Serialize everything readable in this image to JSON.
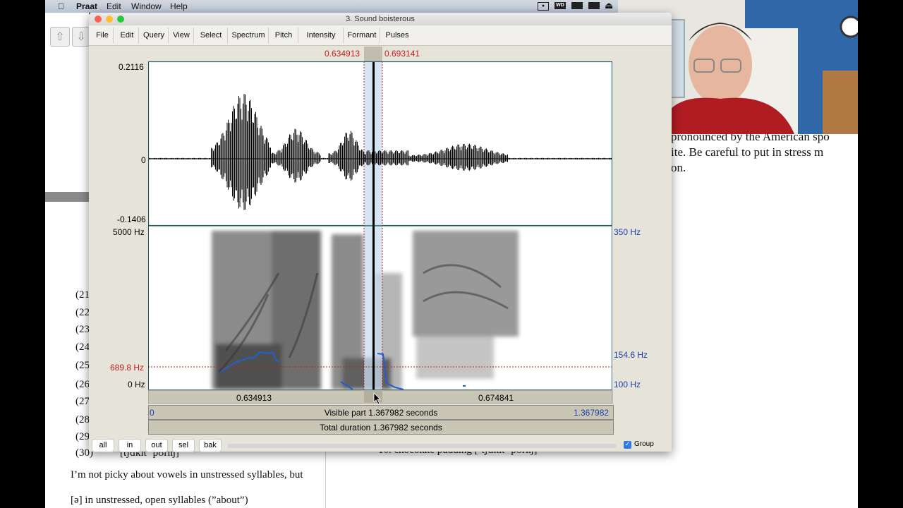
{
  "menubar": {
    "apple": "",
    "app": "Praat",
    "items": [
      "Edit",
      "Window",
      "Help"
    ]
  },
  "window": {
    "title": "3. Sound boisterous",
    "menus": [
      "File",
      "Edit",
      "Query",
      "View",
      "Select",
      "Spectrum",
      "Pitch",
      "Intensity",
      "Formant",
      "Pulses"
    ]
  },
  "selection": {
    "start": "0.634913",
    "end": "0.693141"
  },
  "waveform": {
    "ymax": "0.2116",
    "zero": "0",
    "ymin": "-0.1406"
  },
  "spectrogram": {
    "fmax": "5000 Hz",
    "fmin": "0 Hz",
    "cursor_freq": "689.8 Hz",
    "pitch_max": "350 Hz",
    "pitch_cursor": "154.6 Hz",
    "pitch_min": "100 Hz"
  },
  "time_bars": {
    "left_segment": "0.634913",
    "right_segment": "0.674841",
    "visible_start": "0",
    "visible_label": "Visible part 1.367982 seconds",
    "visible_end": "1.367982",
    "total_label": "Total duration 1.367982 seconds"
  },
  "bottom": {
    "buttons": [
      "all",
      "in",
      "out",
      "sel",
      "bak"
    ],
    "group_label": "Group",
    "group_checked": true
  },
  "document": {
    "right_lines": [
      "pronounced by the American spo",
      "ite.  Be careful to put in stress m",
      "on."
    ],
    "left_numbers": [
      "(21",
      "(22",
      "(23",
      "(24",
      "(25",
      "(26",
      "(27",
      "(28",
      "(29",
      "(30)"
    ],
    "item30": "[tʃɑkit ˈpʊɾiŋ]",
    "right_item": "10. chocolate pudding  [ˈtʃɑkit ˈpʊɾiŋ]",
    "line1": "I’m not picky about vowels in unstressed syllables, but",
    "line2": "[ə] in unstressed, open syllables (”about”)"
  },
  "colors": {
    "selection": "#c8dcf0",
    "pitch": "#1f5fcf",
    "accent_red": "#c21f1f",
    "accent_blue": "#1a3fb0"
  }
}
